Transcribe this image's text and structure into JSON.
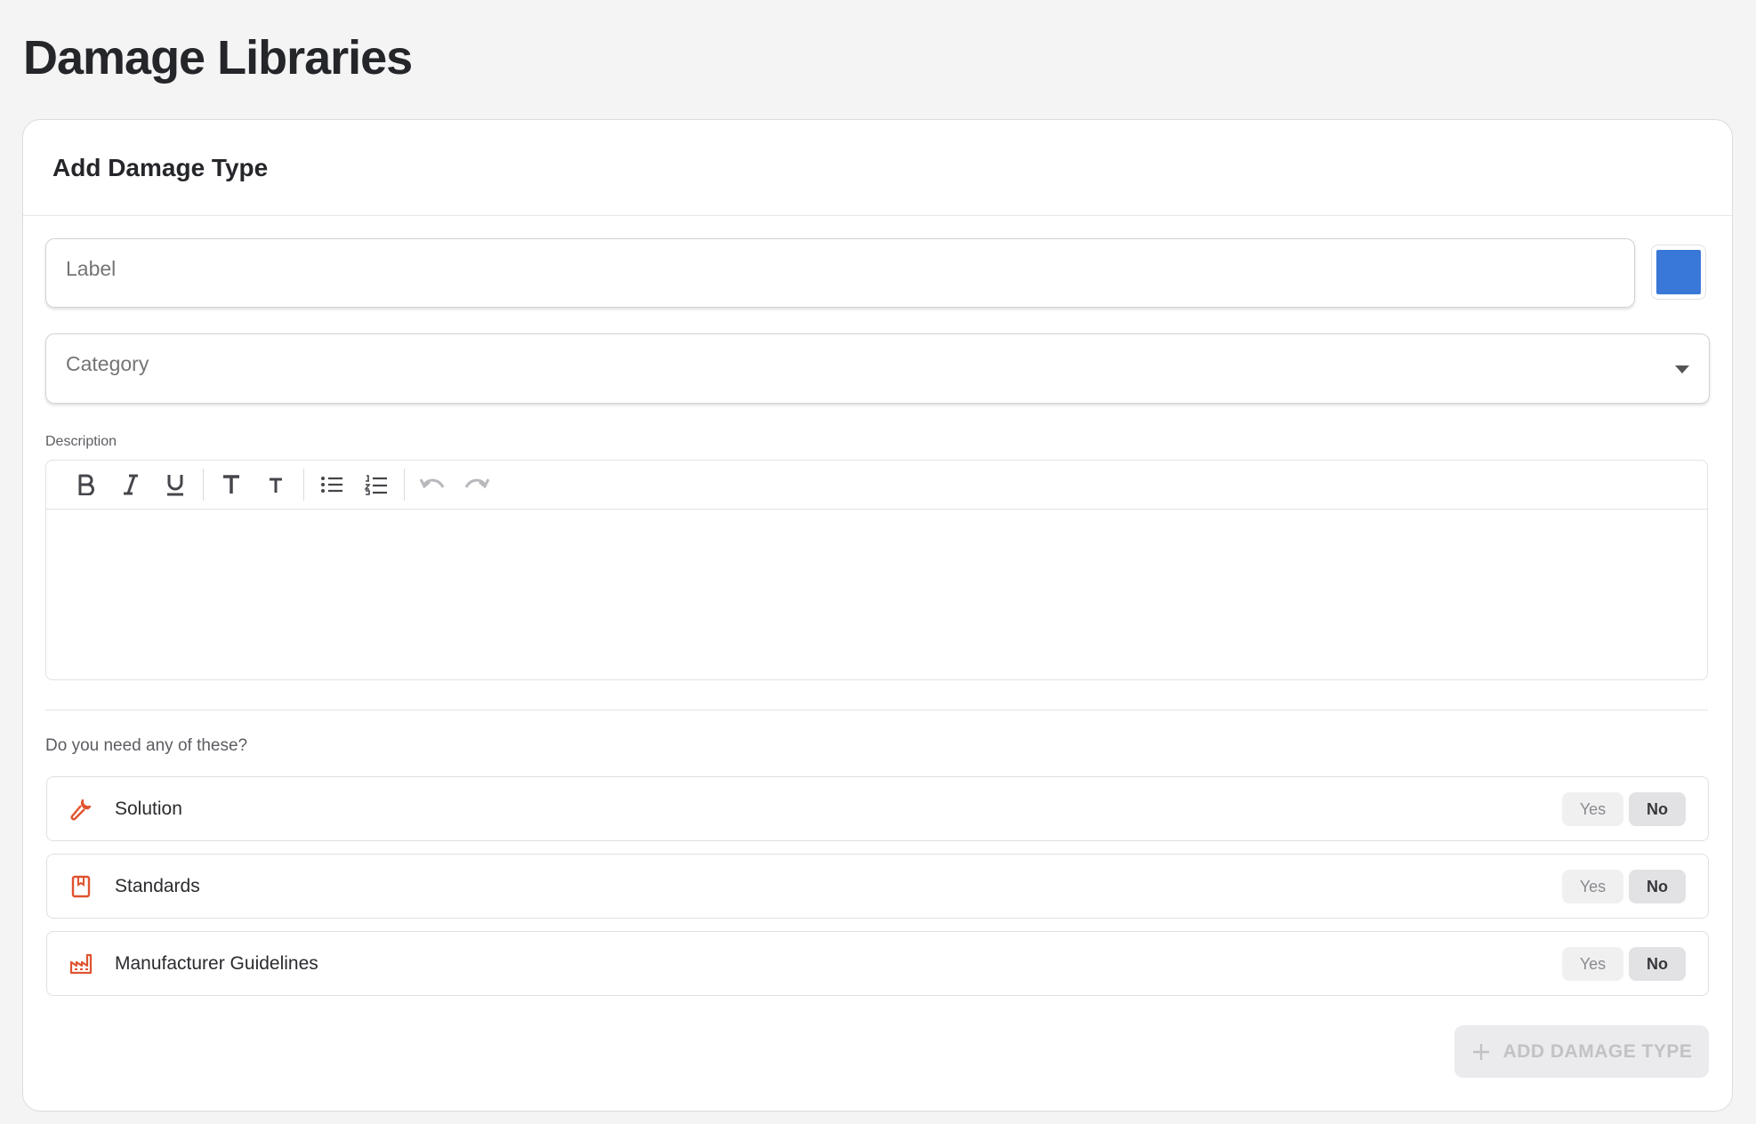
{
  "page": {
    "title": "Damage Libraries"
  },
  "form": {
    "title": "Add Damage Type",
    "label_field": {
      "placeholder": "Label",
      "value": ""
    },
    "color": {
      "hex": "#3a78d8"
    },
    "category_field": {
      "placeholder": "Category",
      "value": ""
    },
    "description": {
      "label": "Description"
    },
    "toolbar": {
      "items": [
        "bold-icon",
        "italic-icon",
        "underline-icon",
        "heading-large-icon",
        "heading-small-icon",
        "bullet-list-icon",
        "numbered-list-icon",
        "undo-icon",
        "redo-icon"
      ]
    },
    "question": "Do you need any of these?",
    "options": [
      {
        "label": "Solution",
        "icon": "wrench-icon",
        "yes": "Yes",
        "no": "No",
        "selected": "No"
      },
      {
        "label": "Standards",
        "icon": "book-icon",
        "yes": "Yes",
        "no": "No",
        "selected": "No"
      },
      {
        "label": "Manufacturer Guidelines",
        "icon": "factory-icon",
        "yes": "Yes",
        "no": "No",
        "selected": "No"
      }
    ],
    "submit_label": "ADD DAMAGE TYPE"
  },
  "colors": {
    "accent_icon": "#e0532f",
    "swatch": "#3a78d8"
  }
}
